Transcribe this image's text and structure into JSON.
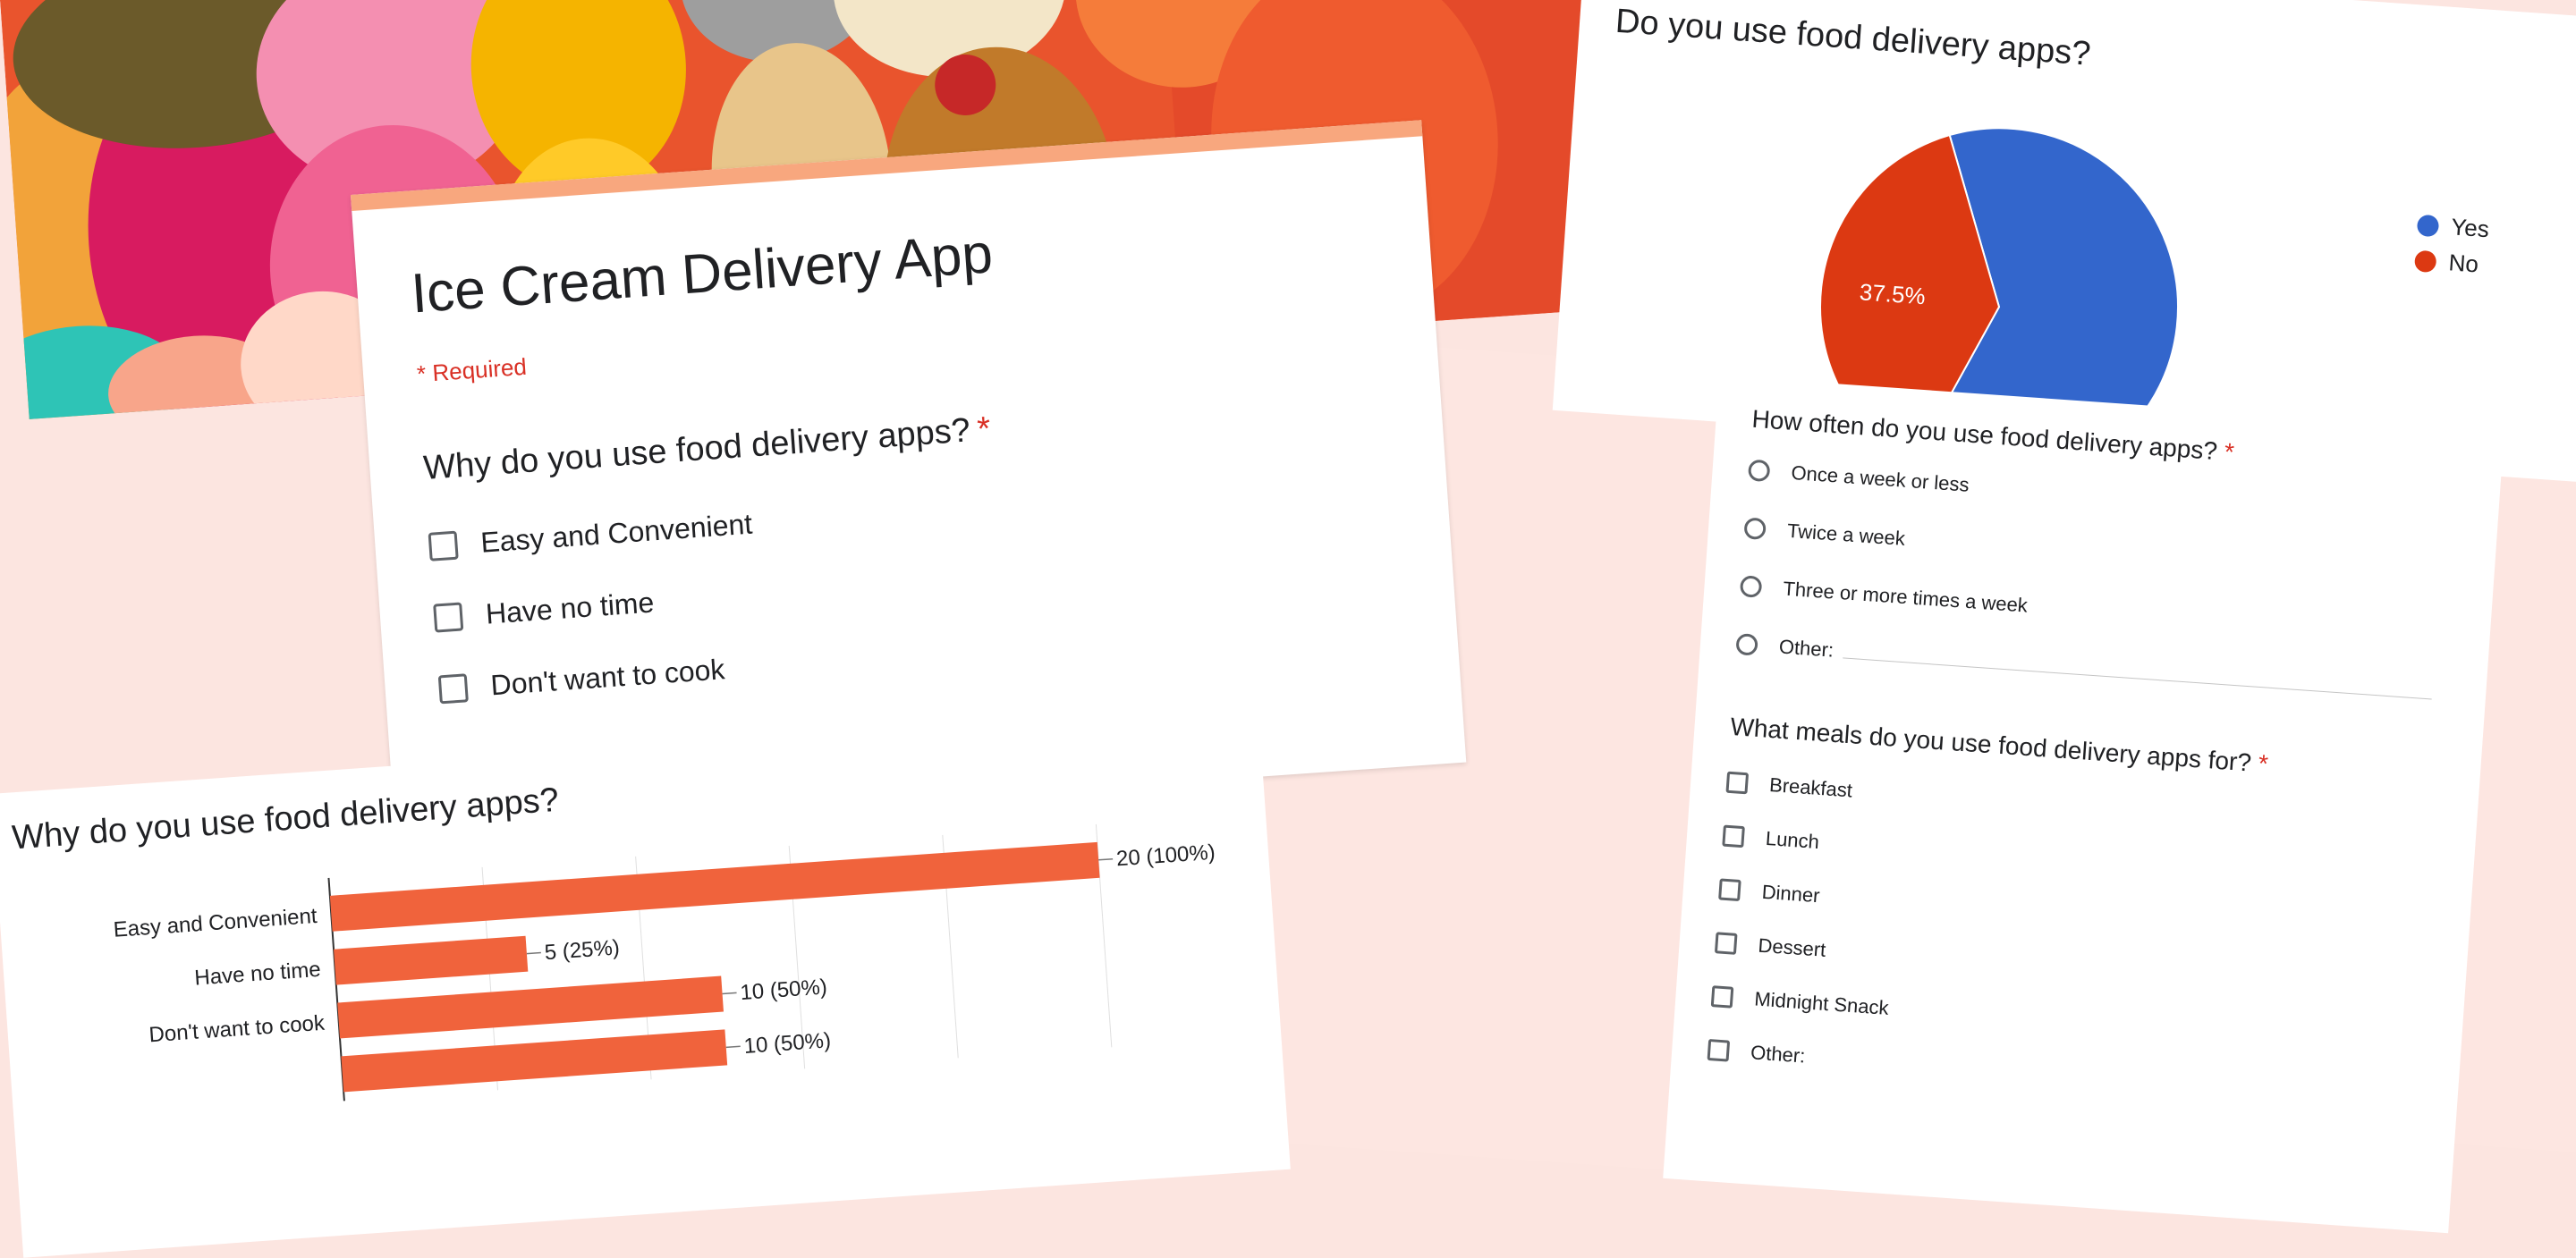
{
  "colors": {
    "accent": "#f8a77e",
    "required": "#d93025",
    "bar": "#f0633c",
    "yes": "#3366cc",
    "no": "#dc3912"
  },
  "form": {
    "title": "Ice Cream Delivery App",
    "required_note": "* Required",
    "question": "Why do you use food delivery apps?",
    "asterisk": "*",
    "options": [
      "Easy and Convenient",
      "Have no time",
      "Don't want to cook"
    ]
  },
  "bar_section": {
    "title": "Why do you use food delivery apps?"
  },
  "chart_data": [
    {
      "type": "bar",
      "orientation": "horizontal",
      "title": "Why do you use food delivery apps?",
      "categories": [
        "Easy and Convenient",
        "Have no time",
        "Don't want to cook",
        ""
      ],
      "values": [
        20,
        5,
        10,
        10
      ],
      "data_labels": [
        "20 (100%)",
        "5 (25%)",
        "10 (50%)",
        "10 (50%)"
      ],
      "xlim": [
        0,
        20
      ],
      "grid": true
    },
    {
      "type": "pie",
      "title": "Do you use food delivery apps?",
      "categories": [
        "Yes",
        "No"
      ],
      "values": [
        62.5,
        37.5
      ],
      "data_labels": [
        "",
        "37.5%"
      ],
      "legend": "right"
    }
  ],
  "pie_section": {
    "title": "Do you use food delivery apps?",
    "legend": [
      "Yes",
      "No"
    ],
    "slice_label": "37.5%"
  },
  "questions": {
    "frequency": {
      "label": "How often do you use food delivery apps?",
      "asterisk": "*",
      "options": [
        "Once a week or less",
        "Twice a week",
        "Three or more times a week",
        "Other:"
      ]
    },
    "meals": {
      "label": "What meals do you use food delivery apps for?",
      "asterisk": "*",
      "options": [
        "Breakfast",
        "Lunch",
        "Dinner",
        "Dessert",
        "Midnight Snack",
        "Other:"
      ]
    }
  }
}
